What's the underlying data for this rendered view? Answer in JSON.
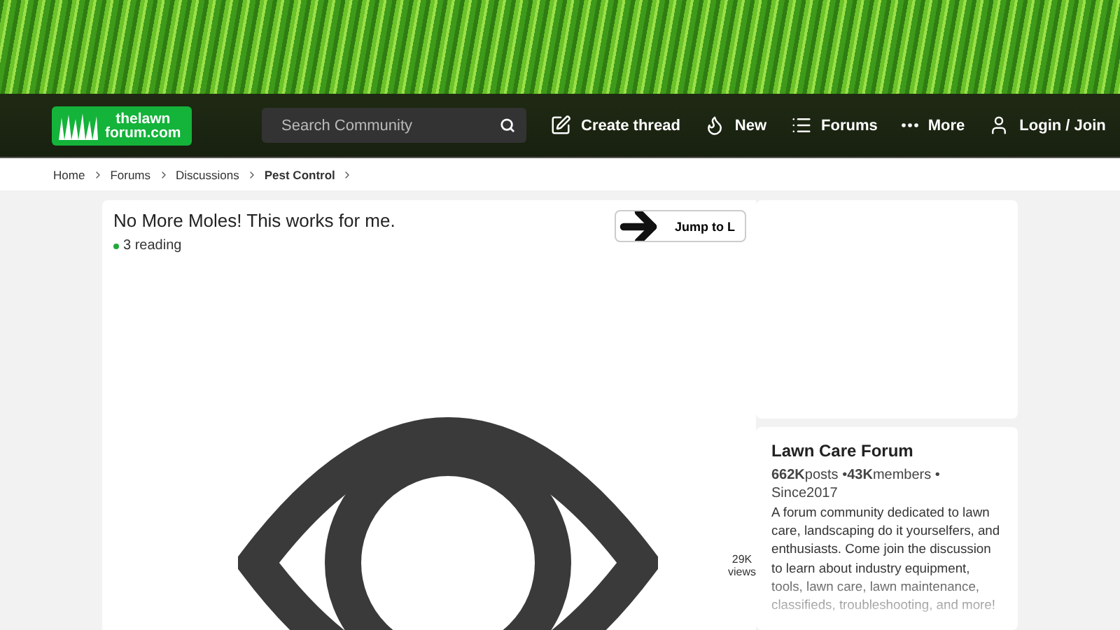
{
  "header": {
    "logo": {
      "line_1": "thelawn",
      "line_2": "forum.com"
    },
    "search": {
      "placeholder": "Search Community"
    },
    "nav": [
      {
        "kind": "create",
        "label": "Create thread"
      },
      {
        "kind": "new",
        "label": "New"
      },
      {
        "kind": "forums",
        "label": "Forums"
      },
      {
        "kind": "more",
        "label": "More"
      },
      {
        "kind": "login",
        "label": "Login / Join"
      }
    ]
  },
  "breadcrumb": [
    {
      "label": "Home",
      "current": false
    },
    {
      "label": "Forums",
      "current": false
    },
    {
      "label": "Discussions",
      "current": false
    },
    {
      "label": "Pest Control",
      "current": true
    }
  ],
  "thread": {
    "title": "No More Moles! This works for me.",
    "reading": "3 reading",
    "jump_button": "Jump to L",
    "views": "29K",
    "views_label": "views"
  },
  "sidebar": {
    "title": "Lawn Care Forum",
    "stats": "**662K**posts •**43K**members • Since2017",
    "description": "A forum community dedicated to lawn care, landscaping do it yourselfers, and enthusiasts. Come join the discussion to learn about industry equipment, tools, lawn care, lawn maintenance, classifieds, troubleshooting, and more!"
  }
}
